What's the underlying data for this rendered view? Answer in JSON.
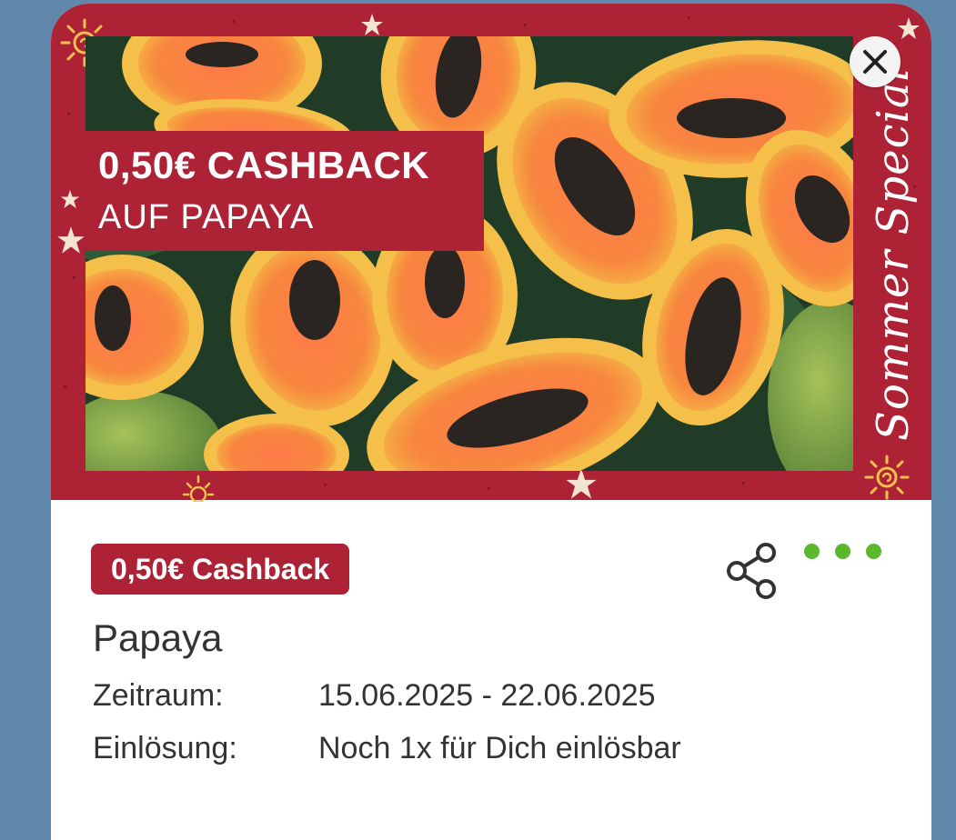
{
  "banner": {
    "headline": "0,50€ CASHBACK",
    "subline": "AUF PAPAYA",
    "side_text": "Sommer Special",
    "close_icon": "close-icon"
  },
  "offer": {
    "badge": "0,50€ Cashback",
    "title": "Papaya",
    "period_label": "Zeitraum:",
    "period_value": "15.06.2025 - 22.06.2025",
    "redeem_label": "Einlösung:",
    "redeem_value": "Noch 1x für Dich einlösbar"
  },
  "actions": {
    "share_icon": "share-icon",
    "more_icon": "more-dots-icon"
  },
  "colors": {
    "brand_red": "#ae2236",
    "dots_green": "#5ab82c",
    "background": "#5f88aa"
  }
}
